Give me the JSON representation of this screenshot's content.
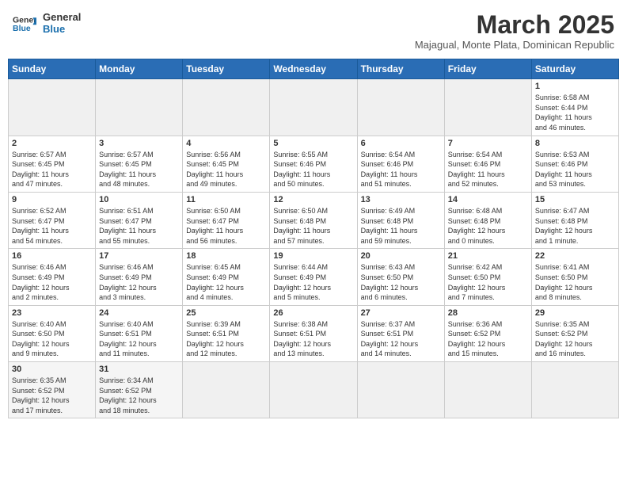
{
  "header": {
    "logo_line1": "General",
    "logo_line2": "Blue",
    "title": "March 2025",
    "subtitle": "Majagual, Monte Plata, Dominican Republic"
  },
  "days_of_week": [
    "Sunday",
    "Monday",
    "Tuesday",
    "Wednesday",
    "Thursday",
    "Friday",
    "Saturday"
  ],
  "weeks": [
    [
      {
        "day": "",
        "info": ""
      },
      {
        "day": "",
        "info": ""
      },
      {
        "day": "",
        "info": ""
      },
      {
        "day": "",
        "info": ""
      },
      {
        "day": "",
        "info": ""
      },
      {
        "day": "",
        "info": ""
      },
      {
        "day": "1",
        "info": "Sunrise: 6:58 AM\nSunset: 6:44 PM\nDaylight: 11 hours\nand 46 minutes."
      }
    ],
    [
      {
        "day": "2",
        "info": "Sunrise: 6:57 AM\nSunset: 6:45 PM\nDaylight: 11 hours\nand 47 minutes."
      },
      {
        "day": "3",
        "info": "Sunrise: 6:57 AM\nSunset: 6:45 PM\nDaylight: 11 hours\nand 48 minutes."
      },
      {
        "day": "4",
        "info": "Sunrise: 6:56 AM\nSunset: 6:45 PM\nDaylight: 11 hours\nand 49 minutes."
      },
      {
        "day": "5",
        "info": "Sunrise: 6:55 AM\nSunset: 6:46 PM\nDaylight: 11 hours\nand 50 minutes."
      },
      {
        "day": "6",
        "info": "Sunrise: 6:54 AM\nSunset: 6:46 PM\nDaylight: 11 hours\nand 51 minutes."
      },
      {
        "day": "7",
        "info": "Sunrise: 6:54 AM\nSunset: 6:46 PM\nDaylight: 11 hours\nand 52 minutes."
      },
      {
        "day": "8",
        "info": "Sunrise: 6:53 AM\nSunset: 6:46 PM\nDaylight: 11 hours\nand 53 minutes."
      }
    ],
    [
      {
        "day": "9",
        "info": "Sunrise: 6:52 AM\nSunset: 6:47 PM\nDaylight: 11 hours\nand 54 minutes."
      },
      {
        "day": "10",
        "info": "Sunrise: 6:51 AM\nSunset: 6:47 PM\nDaylight: 11 hours\nand 55 minutes."
      },
      {
        "day": "11",
        "info": "Sunrise: 6:50 AM\nSunset: 6:47 PM\nDaylight: 11 hours\nand 56 minutes."
      },
      {
        "day": "12",
        "info": "Sunrise: 6:50 AM\nSunset: 6:48 PM\nDaylight: 11 hours\nand 57 minutes."
      },
      {
        "day": "13",
        "info": "Sunrise: 6:49 AM\nSunset: 6:48 PM\nDaylight: 11 hours\nand 59 minutes."
      },
      {
        "day": "14",
        "info": "Sunrise: 6:48 AM\nSunset: 6:48 PM\nDaylight: 12 hours\nand 0 minutes."
      },
      {
        "day": "15",
        "info": "Sunrise: 6:47 AM\nSunset: 6:48 PM\nDaylight: 12 hours\nand 1 minute."
      }
    ],
    [
      {
        "day": "16",
        "info": "Sunrise: 6:46 AM\nSunset: 6:49 PM\nDaylight: 12 hours\nand 2 minutes."
      },
      {
        "day": "17",
        "info": "Sunrise: 6:46 AM\nSunset: 6:49 PM\nDaylight: 12 hours\nand 3 minutes."
      },
      {
        "day": "18",
        "info": "Sunrise: 6:45 AM\nSunset: 6:49 PM\nDaylight: 12 hours\nand 4 minutes."
      },
      {
        "day": "19",
        "info": "Sunrise: 6:44 AM\nSunset: 6:49 PM\nDaylight: 12 hours\nand 5 minutes."
      },
      {
        "day": "20",
        "info": "Sunrise: 6:43 AM\nSunset: 6:50 PM\nDaylight: 12 hours\nand 6 minutes."
      },
      {
        "day": "21",
        "info": "Sunrise: 6:42 AM\nSunset: 6:50 PM\nDaylight: 12 hours\nand 7 minutes."
      },
      {
        "day": "22",
        "info": "Sunrise: 6:41 AM\nSunset: 6:50 PM\nDaylight: 12 hours\nand 8 minutes."
      }
    ],
    [
      {
        "day": "23",
        "info": "Sunrise: 6:40 AM\nSunset: 6:50 PM\nDaylight: 12 hours\nand 9 minutes."
      },
      {
        "day": "24",
        "info": "Sunrise: 6:40 AM\nSunset: 6:51 PM\nDaylight: 12 hours\nand 11 minutes."
      },
      {
        "day": "25",
        "info": "Sunrise: 6:39 AM\nSunset: 6:51 PM\nDaylight: 12 hours\nand 12 minutes."
      },
      {
        "day": "26",
        "info": "Sunrise: 6:38 AM\nSunset: 6:51 PM\nDaylight: 12 hours\nand 13 minutes."
      },
      {
        "day": "27",
        "info": "Sunrise: 6:37 AM\nSunset: 6:51 PM\nDaylight: 12 hours\nand 14 minutes."
      },
      {
        "day": "28",
        "info": "Sunrise: 6:36 AM\nSunset: 6:52 PM\nDaylight: 12 hours\nand 15 minutes."
      },
      {
        "day": "29",
        "info": "Sunrise: 6:35 AM\nSunset: 6:52 PM\nDaylight: 12 hours\nand 16 minutes."
      }
    ],
    [
      {
        "day": "30",
        "info": "Sunrise: 6:35 AM\nSunset: 6:52 PM\nDaylight: 12 hours\nand 17 minutes."
      },
      {
        "day": "31",
        "info": "Sunrise: 6:34 AM\nSunset: 6:52 PM\nDaylight: 12 hours\nand 18 minutes."
      },
      {
        "day": "",
        "info": ""
      },
      {
        "day": "",
        "info": ""
      },
      {
        "day": "",
        "info": ""
      },
      {
        "day": "",
        "info": ""
      },
      {
        "day": "",
        "info": ""
      }
    ]
  ]
}
